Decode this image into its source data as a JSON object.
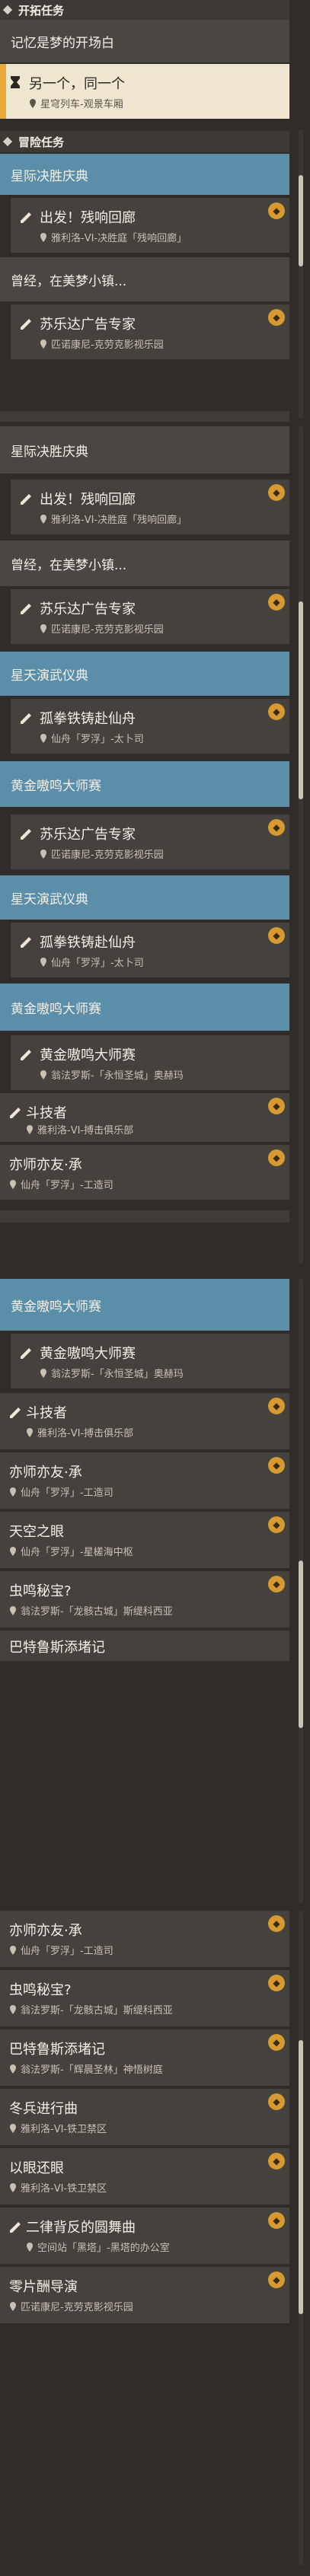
{
  "sections": {
    "trailblaze": "开拓任务",
    "adventure": "冒险任务"
  },
  "groups": {
    "dream": "记忆是梦的开场白",
    "star": "星际决胜庆典",
    "once": "曾经，在美梦小镇...",
    "stardance": "星天演武仪典",
    "golden": "黄金嗷鸣大师赛"
  },
  "quests": {
    "another_one": {
      "title": "另一个，同一个",
      "loc": "星穹列车-观景车厢"
    },
    "depart": {
      "title": "出发！残响回廊",
      "loc": "雅利洛-VI-决胜庭「残响回廊」"
    },
    "depart2": {
      "title": "出发！残响回廊",
      "loc": "雅利洛-VI-决胜庭「残响回廊」"
    },
    "sule": {
      "title": "苏乐达广告专家",
      "loc": "匹诺康尼-克劳克影视乐园"
    },
    "fist": {
      "title": "孤拳铁铸赴仙舟",
      "loc": "仙舟「罗浮」-太卜司"
    },
    "golden_master": {
      "title": "黄金嗷鸣大师赛",
      "loc": "翁法罗斯-「永恒圣城」奥赫玛"
    },
    "fighter": {
      "title": "斗技者",
      "loc": "雅利洛-VI-搏击俱乐部"
    },
    "teacher": {
      "title": "亦师亦友·承",
      "loc": "仙舟「罗浮」-工造司"
    },
    "skyeye": {
      "title": "天空之眼",
      "loc": "仙舟「罗浮」-星槎海中枢"
    },
    "bug": {
      "title": "虫鸣秘宝?",
      "loc": "翁法罗斯-「龙骸古城」斯缇科西亚"
    },
    "batrus": {
      "title": "巴特鲁斯添堵记",
      "loc": "翁法罗斯-「辉晨圣林」神悟树庭"
    },
    "winter": {
      "title": "冬兵进行曲",
      "loc": "雅利洛-VI-铁卫禁区"
    },
    "eye4eye": {
      "title": "以眼还眼",
      "loc": "雅利洛-VI-铁卫禁区"
    },
    "waltz": {
      "title": "二律背反的圆舞曲",
      "loc": "空间站「黑塔」-黑塔的办公室"
    },
    "zero": {
      "title": "零片酬导演",
      "loc": "匹诺康尼-克劳克影视乐园"
    }
  },
  "icons": {
    "quest": "quest-marker-icon",
    "location": "location-pin-icon",
    "badge": "reward-badge-icon"
  },
  "colors": {
    "accent": "#e6a93a",
    "group_blue": "#5a8ea9",
    "panel": "#45423e"
  }
}
